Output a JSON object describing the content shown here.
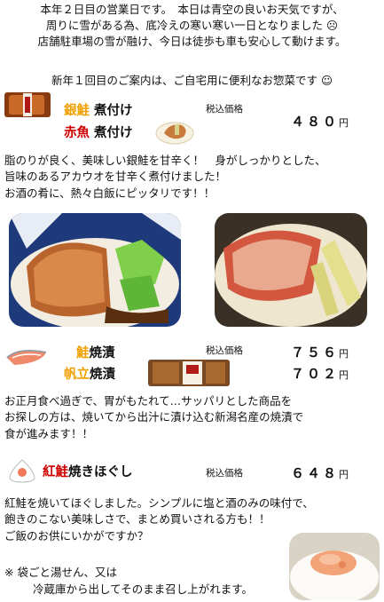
{
  "intro": {
    "line1": "本年２日目の営業日です。　本日は青空の良いお天気ですが、",
    "line2": "周りに雪がある為、底冷えの寒い寒い一日となりました ☹",
    "line3": "店舗駐車場の雪が融け、今日は徒歩も車も安心して動けます。"
  },
  "guide": "新年１回目のご案内は、ご自宅用に便利なお惣菜です ☺",
  "product1": {
    "name_a_accent": "銀鮭",
    "name_a_rest": " 煮付け",
    "name_b_accent": "赤魚",
    "name_b_rest": " 煮付け",
    "tax_label": "税込価格",
    "price": "４８０",
    "yen": "円",
    "desc1": "脂のりが良く、美味しい銀鮭を甘辛く！　身がしっかりとした、",
    "desc2": "旨味のあるアカウオを甘辛く煮付けました！",
    "desc3": "お酒の肴に、熱々白飯にピッタリです！！"
  },
  "product2": {
    "name_a_accent": "鮭",
    "name_a_rest": "焼漬",
    "name_b_accent": "帆立",
    "name_b_rest": "焼漬",
    "tax_label": "税込価格",
    "price_a": "７５６",
    "price_b": "７０２",
    "yen": "円",
    "desc1": "お正月食べ過ぎで、胃がもたれて…サッパリとした商品を",
    "desc2": "お探しの方は、焼いてから出汁に漬け込む新潟名産の焼漬で",
    "desc3": "食が進みます！！"
  },
  "product3": {
    "name_accent": "紅鮭",
    "name_rest": "焼きほぐし",
    "tax_label": "税込価格",
    "price": "６４８",
    "yen": "円",
    "desc1": "紅鮭を焼いてほぐしました。シンプルに塩と酒のみの味付で、",
    "desc2": "飽きのこない美味しさで、まとめ買いされる方も！！",
    "desc3": "ご飯のお供にいかがですか？"
  },
  "note": {
    "line1": "※ 袋ごと湯せん、又は",
    "line2": "冷蔵庫から出してそのまま召し上がれます。"
  },
  "colors": {
    "accent": "#f0a000",
    "red": "#d00000"
  }
}
